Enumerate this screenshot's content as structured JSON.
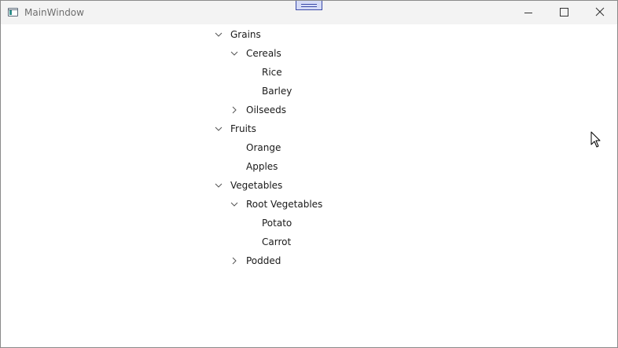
{
  "window": {
    "title": "MainWindow"
  },
  "icons": {
    "app": "app-window-icon",
    "minimize": "minimize-icon",
    "maximize": "maximize-icon",
    "close": "close-icon",
    "expanded": "chevron-down-icon",
    "collapsed": "chevron-right-icon",
    "cursor": "mouse-pointer-icon"
  },
  "colors": {
    "titlebar": "#f3f3f3",
    "text": "#1a1a1a",
    "title_text": "#6f6f6f",
    "handle_fill": "#d5dbf7",
    "handle_border": "#3b4aa8"
  },
  "tree": {
    "grains": {
      "label": "Grains",
      "expanded": true,
      "cereals": {
        "label": "Cereals",
        "expanded": true,
        "rice": {
          "label": "Rice"
        },
        "barley": {
          "label": "Barley"
        }
      },
      "oilseeds": {
        "label": "Oilseeds",
        "expanded": false
      }
    },
    "fruits": {
      "label": "Fruits",
      "expanded": true,
      "orange": {
        "label": "Orange"
      },
      "apples": {
        "label": "Apples"
      }
    },
    "vegetables": {
      "label": "Vegetables",
      "expanded": true,
      "root": {
        "label": "Root Vegetables",
        "expanded": true,
        "potato": {
          "label": "Potato"
        },
        "carrot": {
          "label": "Carrot"
        }
      },
      "podded": {
        "label": "Podded",
        "expanded": false
      }
    }
  }
}
